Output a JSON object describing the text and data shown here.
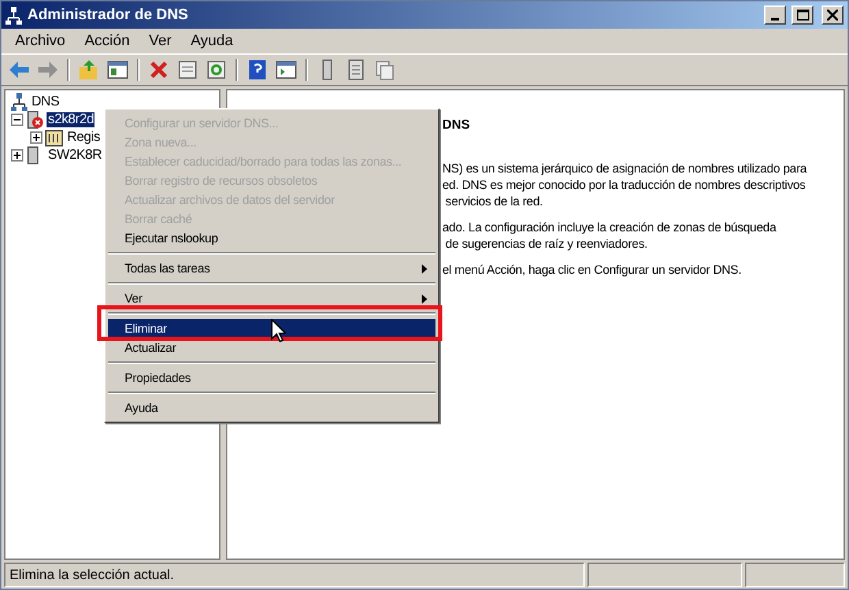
{
  "window": {
    "title": "Administrador de DNS"
  },
  "menubar": [
    "Archivo",
    "Acción",
    "Ver",
    "Ayuda"
  ],
  "tree": [
    {
      "label": "DNS",
      "kind": "root",
      "selected": false,
      "children": [
        {
          "label": "s2k8r2d",
          "kind": "server",
          "error": true,
          "selected": true,
          "expanded": true,
          "children": [
            {
              "label": "Regis",
              "kind": "log",
              "selected": false,
              "expanded": false
            }
          ]
        },
        {
          "label": "SW2K8R",
          "kind": "server",
          "error": false,
          "selected": false,
          "expanded": false
        }
      ]
    }
  ],
  "details": {
    "heading": "DNS",
    "paragraphs": [
      [
        "NS) es un sistema jerárquico de asignación de nombres utilizado para",
        "ed. DNS es mejor conocido por la traducción de nombres descriptivos",
        " servicios de la red."
      ],
      [
        "ado. La configuración incluye la creación de zonas de búsqueda",
        " de sugerencias de raíz y reenviadores."
      ],
      [
        "el menú Acción, haga clic en Configurar un servidor DNS."
      ]
    ]
  },
  "context_menu": [
    {
      "kind": "item",
      "label": "Configurar un servidor DNS...",
      "disabled": true,
      "selected": false,
      "submenu": false
    },
    {
      "kind": "item",
      "label": "Zona nueva...",
      "disabled": true,
      "selected": false,
      "submenu": false
    },
    {
      "kind": "item",
      "label": "Establecer caducidad/borrado para todas las zonas...",
      "disabled": true,
      "selected": false,
      "submenu": false
    },
    {
      "kind": "item",
      "label": "Borrar registro de recursos obsoletos",
      "disabled": true,
      "selected": false,
      "submenu": false
    },
    {
      "kind": "item",
      "label": "Actualizar archivos de datos del servidor",
      "disabled": true,
      "selected": false,
      "submenu": false
    },
    {
      "kind": "item",
      "label": "Borrar caché",
      "disabled": true,
      "selected": false,
      "submenu": false
    },
    {
      "kind": "item",
      "label": "Ejecutar nslookup",
      "disabled": false,
      "selected": false,
      "submenu": false
    },
    {
      "kind": "separator"
    },
    {
      "kind": "item",
      "label": "Todas las tareas",
      "disabled": false,
      "selected": false,
      "submenu": true
    },
    {
      "kind": "separator"
    },
    {
      "kind": "item",
      "label": "Ver",
      "disabled": false,
      "selected": false,
      "submenu": true
    },
    {
      "kind": "separator"
    },
    {
      "kind": "item",
      "label": "Eliminar",
      "disabled": false,
      "selected": true,
      "submenu": false
    },
    {
      "kind": "item",
      "label": "Actualizar",
      "disabled": false,
      "selected": false,
      "submenu": false
    },
    {
      "kind": "separator"
    },
    {
      "kind": "item",
      "label": "Propiedades",
      "disabled": false,
      "selected": false,
      "submenu": false
    },
    {
      "kind": "separator"
    },
    {
      "kind": "item",
      "label": "Ayuda",
      "disabled": false,
      "selected": false,
      "submenu": false
    }
  ],
  "status_bar": {
    "text": "Elimina la selección actual."
  }
}
